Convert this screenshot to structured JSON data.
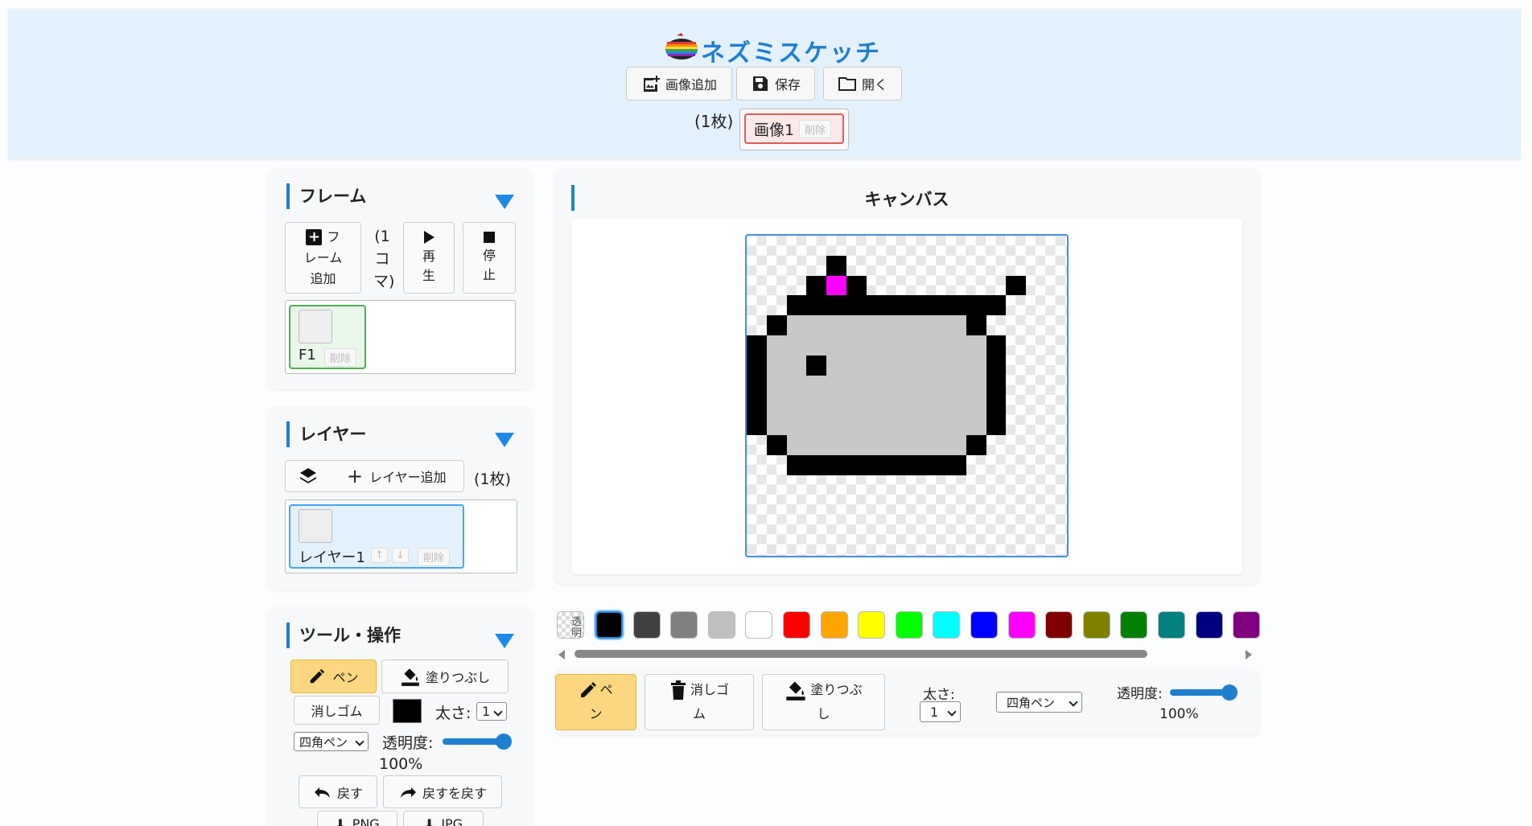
{
  "app": {
    "title": "ネズミスケッチ"
  },
  "header": {
    "add_image": "画像追加",
    "save": "保存",
    "open": "開く",
    "image_count": "(1枚)",
    "image_tab": {
      "label": "画像1",
      "delete": "削除"
    }
  },
  "frames": {
    "title": "フレーム",
    "add_label_1": "フ",
    "add_label_2": "レーム",
    "add_label_3": "追加",
    "count_1": "(1",
    "count_2": "コ",
    "count_3": "マ)",
    "play_1": "再",
    "play_2": "生",
    "stop_1": "停",
    "stop_2": "止",
    "item": {
      "label": "F1",
      "delete": "削除"
    }
  },
  "layers": {
    "title": "レイヤー",
    "add": "レイヤー追加",
    "count": "(1枚)",
    "item": {
      "label": "レイヤー1",
      "up": "↑",
      "down": "↓",
      "delete": "削除"
    }
  },
  "tools": {
    "title": "ツール・操作",
    "pen": "ペン",
    "fill": "塗りつぶし",
    "eraser": "消しゴム",
    "size_label": "太さ:",
    "size_value": "1",
    "pen_shape": "四角ペン",
    "opacity_label": "透明度:",
    "opacity_value": "100%",
    "undo": "戻す",
    "redo": "戻すを戻す",
    "png": "PNG",
    "jpg": "JPG"
  },
  "canvas": {
    "title": "キャンバス"
  },
  "palette": {
    "transparent_label": "透明",
    "colors": [
      "#000000",
      "#404040",
      "#808080",
      "#c0c0c0",
      "#ffffff",
      "#ff0000",
      "#ffa500",
      "#ffff00",
      "#00ff00",
      "#00ffff",
      "#0000ff",
      "#ff00ff",
      "#800000",
      "#808000",
      "#008000",
      "#008080",
      "#000080",
      "#800080"
    ],
    "selected": "#000000"
  },
  "bottom_toolbar": {
    "pen_1": "ペ",
    "pen_2": "ン",
    "eraser_1": "消しゴ",
    "eraser_2": "ム",
    "fill_1": "塗りつぶ",
    "fill_2": "し",
    "size_label": "太さ:",
    "size_value": "1",
    "pen_shape": "四角ペン",
    "opacity_label": "透明度:",
    "opacity_value": "100%"
  }
}
